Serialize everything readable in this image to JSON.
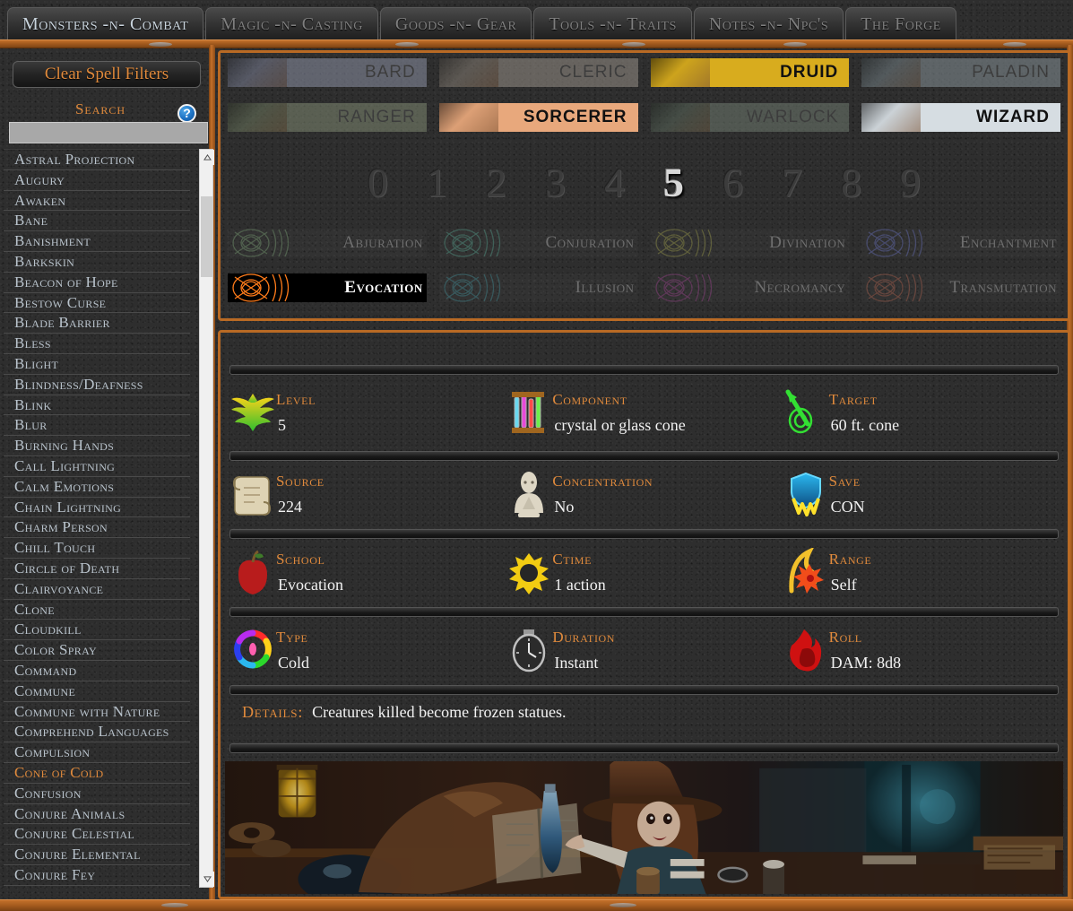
{
  "tabs": [
    {
      "label": "Monsters -n- Combat",
      "active": true
    },
    {
      "label": "Magic -n- Casting",
      "active": false
    },
    {
      "label": "Goods -n- Gear",
      "active": false
    },
    {
      "label": "Tools -n- Traits",
      "active": false
    },
    {
      "label": "Notes -n- Npc's",
      "active": false
    },
    {
      "label": "The Forge",
      "active": false
    }
  ],
  "sidebar": {
    "clear_button": "Clear Spell Filters",
    "search_label": "Search",
    "help_icon": "question-mark-icon",
    "search_value": "",
    "search_placeholder": "",
    "spells": [
      {
        "name": "Astral Projection",
        "selected": false
      },
      {
        "name": "Augury",
        "selected": false
      },
      {
        "name": "Awaken",
        "selected": false
      },
      {
        "name": "Bane",
        "selected": false
      },
      {
        "name": "Banishment",
        "selected": false
      },
      {
        "name": "Barkskin",
        "selected": false
      },
      {
        "name": "Beacon of Hope",
        "selected": false
      },
      {
        "name": "Bestow Curse",
        "selected": false
      },
      {
        "name": "Blade Barrier",
        "selected": false
      },
      {
        "name": "Bless",
        "selected": false
      },
      {
        "name": "Blight",
        "selected": false
      },
      {
        "name": "Blindness/Deafness",
        "selected": false
      },
      {
        "name": "Blink",
        "selected": false
      },
      {
        "name": "Blur",
        "selected": false
      },
      {
        "name": "Burning Hands",
        "selected": false
      },
      {
        "name": "Call Lightning",
        "selected": false
      },
      {
        "name": "Calm Emotions",
        "selected": false
      },
      {
        "name": "Chain Lightning",
        "selected": false
      },
      {
        "name": "Charm Person",
        "selected": false
      },
      {
        "name": "Chill Touch",
        "selected": false
      },
      {
        "name": "Circle of Death",
        "selected": false
      },
      {
        "name": "Clairvoyance",
        "selected": false
      },
      {
        "name": "Clone",
        "selected": false
      },
      {
        "name": "Cloudkill",
        "selected": false
      },
      {
        "name": "Color Spray",
        "selected": false
      },
      {
        "name": "Command",
        "selected": false
      },
      {
        "name": "Commune",
        "selected": false
      },
      {
        "name": "Commune with Nature",
        "selected": false
      },
      {
        "name": "Comprehend Languages",
        "selected": false
      },
      {
        "name": "Compulsion",
        "selected": false
      },
      {
        "name": "Cone of Cold",
        "selected": true
      },
      {
        "name": "Confusion",
        "selected": false
      },
      {
        "name": "Conjure Animals",
        "selected": false
      },
      {
        "name": "Conjure Celestial",
        "selected": false
      },
      {
        "name": "Conjure Elemental",
        "selected": false
      },
      {
        "name": "Conjure Fey",
        "selected": false
      }
    ]
  },
  "filters": {
    "classes": [
      {
        "label": "BARD",
        "active": false,
        "tint": "#7f849a"
      },
      {
        "label": "CLERIC",
        "active": false,
        "tint": "#8b8379"
      },
      {
        "label": "DRUID",
        "active": true,
        "tint": "#d8ac1e"
      },
      {
        "label": "PALADIN",
        "active": false,
        "tint": "#78858a"
      },
      {
        "label": "RANGER",
        "active": false,
        "tint": "#6f7b61"
      },
      {
        "label": "SORCERER",
        "active": true,
        "tint": "#e8a87c"
      },
      {
        "label": "WARLOCK",
        "active": false,
        "tint": "#5d6b5e"
      },
      {
        "label": "WIZARD",
        "active": true,
        "tint": "#d6dde2"
      }
    ],
    "levels": [
      {
        "label": "0",
        "active": false
      },
      {
        "label": "1",
        "active": false
      },
      {
        "label": "2",
        "active": false
      },
      {
        "label": "3",
        "active": false
      },
      {
        "label": "4",
        "active": false
      },
      {
        "label": "5",
        "active": true
      },
      {
        "label": "6",
        "active": false
      },
      {
        "label": "7",
        "active": false
      },
      {
        "label": "8",
        "active": false
      },
      {
        "label": "9",
        "active": false
      }
    ],
    "schools": [
      {
        "label": "Abjuration",
        "active": false,
        "sigil": "#6f8f6a"
      },
      {
        "label": "Conjuration",
        "active": false,
        "sigil": "#4e8f7e"
      },
      {
        "label": "Divination",
        "active": false,
        "sigil": "#8a8a46"
      },
      {
        "label": "Enchantment",
        "active": false,
        "sigil": "#5f66a8"
      },
      {
        "label": "Evocation",
        "active": true,
        "sigil": "#ff7b1a"
      },
      {
        "label": "Illusion",
        "active": false,
        "sigil": "#3f7f86"
      },
      {
        "label": "Necromancy",
        "active": false,
        "sigil": "#8a3f7e"
      },
      {
        "label": "Transmutation",
        "active": false,
        "sigil": "#9a5a4a"
      }
    ]
  },
  "spell_detail": {
    "rows": [
      [
        {
          "key": "Level",
          "value": "5",
          "icon": "phoenix-icon"
        },
        {
          "key": "Component",
          "value": "crystal or glass cone",
          "icon": "test-tubes-icon"
        },
        {
          "key": "Target",
          "value": "60 ft. cone",
          "icon": "dart-target-icon"
        }
      ],
      [
        {
          "key": "Source",
          "value": "224",
          "icon": "scroll-icon"
        },
        {
          "key": "Concentration",
          "value": "No",
          "icon": "meditating-figure-icon"
        },
        {
          "key": "Save",
          "value": "CON",
          "icon": "shield-lightning-icon"
        }
      ],
      [
        {
          "key": "School",
          "value": "Evocation",
          "icon": "apple-icon"
        },
        {
          "key": "Ctime",
          "value": "1 action",
          "icon": "sun-flare-icon"
        },
        {
          "key": "Range",
          "value": "Self",
          "icon": "flame-burst-icon"
        }
      ],
      [
        {
          "key": "Type",
          "value": "Cold",
          "icon": "color-wheel-icon"
        },
        {
          "key": "Duration",
          "value": "Instant",
          "icon": "pocket-watch-icon"
        },
        {
          "key": "Roll",
          "value": "DAM: 8d8",
          "icon": "fire-dice-icon"
        }
      ]
    ],
    "details_label": "Details:",
    "details_text": "Creatures killed become frozen statues.",
    "artwork": "witch-in-study-artwork"
  },
  "colors": {
    "accent_orange": "#e08a3c",
    "frame_orange": "#b96a24",
    "text_light": "#f2f2f2",
    "list_text": "#b9c3cc",
    "background": "#2e2e2e"
  }
}
